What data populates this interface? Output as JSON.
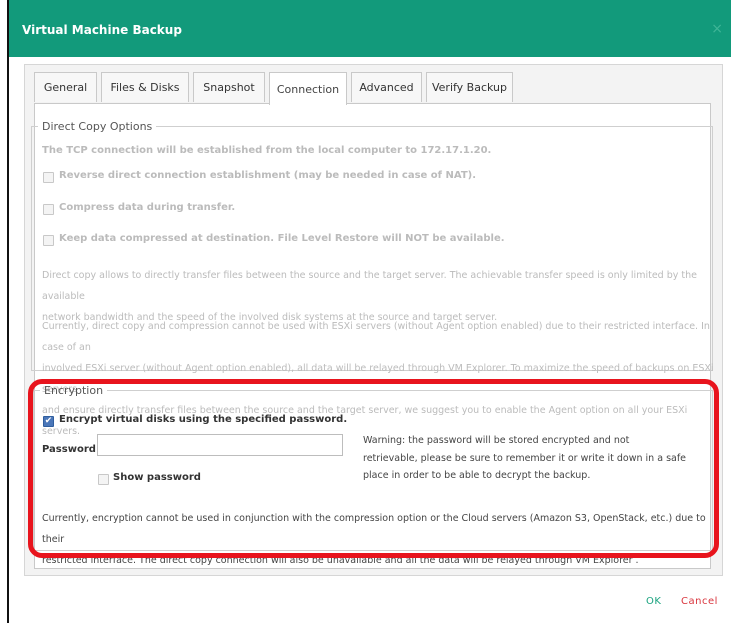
{
  "window": {
    "title": "Virtual Machine Backup",
    "close_glyph": "×"
  },
  "tabs": [
    {
      "label": "General"
    },
    {
      "label": "Files & Disks"
    },
    {
      "label": "Snapshot"
    },
    {
      "label": "Connection"
    },
    {
      "label": "Advanced"
    },
    {
      "label": "Verify Backup"
    }
  ],
  "active_tab": "Connection",
  "direct_copy": {
    "legend": "Direct Copy Options",
    "header": "The TCP connection will be established from the local computer to 172.17.1.20.",
    "options": [
      {
        "label": "Reverse direct connection establishment (may be needed in case of NAT).",
        "checked": false
      },
      {
        "label": "Compress data during transfer.",
        "checked": false
      },
      {
        "label": "Keep data compressed at destination. File Level Restore will NOT be available.",
        "checked": false
      }
    ],
    "para1_line1": "Direct copy allows to directly transfer files between the source and the target server. The achievable transfer speed is only limited by the available",
    "para1_line2": "network bandwidth and the speed of the involved disk systems at the source and target server.",
    "para2_line1": "Currently, direct copy and compression cannot be used with ESXi servers (without Agent option enabled) due to their restricted interface. In case of an",
    "para2_line2": "involved ESXi server (without Agent option enabled), all data will be relayed through VM Explorer. To maximize the speed of backups on ESXi servers",
    "para2_line3": "and ensure directly transfer files between the source and the target server, we suggest you to enable the Agent option on all your ESXi servers."
  },
  "encryption": {
    "legend": "Encryption",
    "encrypt_label": "Encrypt virtual disks using the specified password.",
    "encrypt_checked": true,
    "password_label": "Password",
    "password_value": "",
    "show_password_label": "Show password",
    "warning_line1": "Warning: the password will be stored encrypted and not",
    "warning_line2": "retrievable, please be sure to remember it or write it down in a safe",
    "warning_line3": "place in order to be able to decrypt the backup.",
    "note_line1": "Currently, encryption cannot be used in conjunction with the compression option or the Cloud servers (Amazon S3, OpenStack, etc.) due to their",
    "note_line2": "restricted interface. The direct copy connection will also be unavailable and all the data will be relayed through VM Explorer ."
  },
  "footer": {
    "ok_label": "OK",
    "cancel_label": "Cancel"
  },
  "colors": {
    "titlebar": "#129a7b",
    "highlight": "#e8141d",
    "ok": "#1aa37f",
    "cancel": "#d9363e"
  }
}
